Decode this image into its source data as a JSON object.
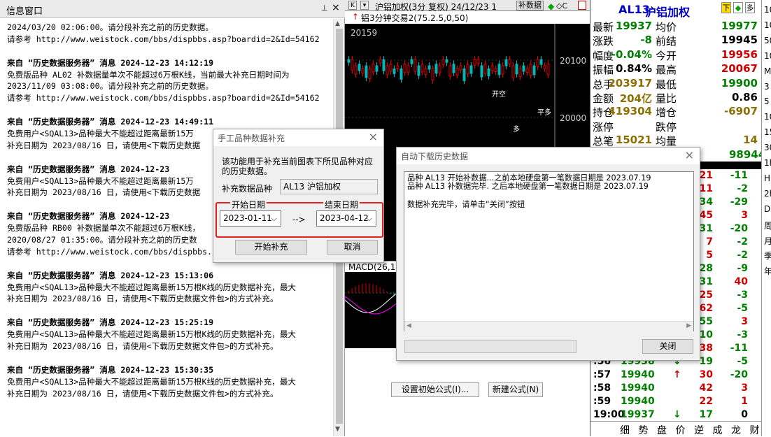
{
  "info_window": {
    "title": "信息窗口",
    "pin": "⊥",
    "close": "×",
    "lines": [
      {
        "t": "2024/03/20 02:06:00。请分段补充之前的历史数据。",
        "b": false
      },
      {
        "t": "请参考 http://www.weistock.com/bbs/dispbbs.asp?boardid=2&Id=54162",
        "b": false
      },
      {
        "t": "",
        "b": false
      },
      {
        "t": "来自 “历史数据服务器” 消息 2024-12-23 14:12:19",
        "b": true
      },
      {
        "t": "免费版品种 AL02 补数据量单次不能超过6万根K线，当前最大补充日期时间为",
        "b": false
      },
      {
        "t": "2023/11/09 03:08:00。请分段补充之前的历史数据。",
        "b": false
      },
      {
        "t": "请参考 http://www.weistock.com/bbs/dispbbs.asp?boardid=2&Id=54162",
        "b": false
      },
      {
        "t": "",
        "b": false
      },
      {
        "t": "来自 “历史数据服务器” 消息 2024-12-23 14:49:11",
        "b": true
      },
      {
        "t": "免费用户<SQAL13>品种最大不能超过距离最新15万",
        "b": false
      },
      {
        "t": "补充日期为 2023/08/16 日，请使用<下载历史数据",
        "b": false
      },
      {
        "t": "",
        "b": false
      },
      {
        "t": "来自 “历史数据服务器” 消息 2024-12-23",
        "b": true
      },
      {
        "t": "免费用户<SQAL13>品种最大不能超过距离最新15万",
        "b": false
      },
      {
        "t": "补充日期为 2023/08/16 日，请使用<下载历史数据",
        "b": false
      },
      {
        "t": "",
        "b": false
      },
      {
        "t": "来自 “历史数据服务器” 消息 2024-12-23",
        "b": true
      },
      {
        "t": "免费版品种 RB00 补数据量单次不能超过6万根K线，",
        "b": false
      },
      {
        "t": "2020/08/27 01:35:00。请分段补充之前的历史数",
        "b": false
      },
      {
        "t": "请参考 http://www.weistock.com/bbs/dispbbs.",
        "b": false
      },
      {
        "t": "",
        "b": false
      },
      {
        "t": "来自 “历史数据服务器” 消息 2024-12-23 15:13:06",
        "b": true
      },
      {
        "t": "免费用户<SQAL13>品种最大不能超过距离最新15万根K线的历史数据补充，最大",
        "b": false
      },
      {
        "t": "补充日期为 2023/08/16 日，请使用<下载历史数据文件包>的方式补充。",
        "b": false
      },
      {
        "t": "",
        "b": false
      },
      {
        "t": "来自 “历史数据服务器” 消息 2024-12-23 15:25:19",
        "b": true
      },
      {
        "t": "免费用户<SQAL13>品种最大不能超过距离最新15万根K线的历史数据补充，最大",
        "b": false
      },
      {
        "t": "补充日期为 2023/08/16 日，请使用<下载历史数据文件包>的方式补充。",
        "b": false
      },
      {
        "t": "",
        "b": false
      },
      {
        "t": "来自 “历史数据服务器” 消息 2024-12-23 15:30:35",
        "b": true
      },
      {
        "t": "免费用户<SQAL13>品种最大不能超过距离最新15万根K线的历史数据补充，最大",
        "b": false
      },
      {
        "t": "补充日期为 2023/08/16 日，请使用<下载历史数据文件包>的方式补充。",
        "b": false
      }
    ]
  },
  "chart": {
    "k_button": "K",
    "header": "沪铝加权(3分  复权) 24/12/23 1",
    "bsj_button": "补数据",
    "indicator": "铝3分钟交易2(75.2.5,0,50)",
    "price_top": "20159",
    "price_mid": "20100",
    "price_low": "20000",
    "macd": "MACD(26,12",
    "btn_formula": "设置初始公式(I)...",
    "btn_new_formula": "新建公式(N)",
    "labels": [
      "开空",
      "多",
      "平多"
    ]
  },
  "quote": {
    "symbol": "AL13",
    "name": "沪铝加权",
    "btn_down": "下",
    "btn_menu": "多",
    "rows": [
      {
        "l1": "最新",
        "v1": "19937",
        "c1": "#008000",
        "l2": "均价",
        "v2": "19977",
        "c2": "#008000"
      },
      {
        "l1": "涨跌",
        "v1": "-8",
        "c1": "#008000",
        "l2": "前结",
        "v2": "19945",
        "c2": "#000"
      },
      {
        "l1": "幅度",
        "v1": "-0.04%",
        "c1": "#008000",
        "l2": "今开",
        "v2": "19956",
        "c2": "#d00000"
      },
      {
        "l1": "振幅",
        "v1": "0.84%",
        "c1": "#000",
        "l2": "最高",
        "v2": "20067",
        "c2": "#d00000"
      },
      {
        "l1": "总手",
        "v1": "203917",
        "c1": "#8b6f00",
        "l2": "最低",
        "v2": "19900",
        "c2": "#008000"
      },
      {
        "l1": "金额",
        "v1": "204亿",
        "c1": "#8b6f00",
        "l2": "量比",
        "v2": "0.86",
        "c2": "#000"
      },
      {
        "l1": "持仓",
        "v1": "419304",
        "c1": "#8b6f00",
        "l2": "增仓",
        "v2": "-6907",
        "c2": "#8b6f00"
      },
      {
        "l1": "涨停",
        "v1": "",
        "c1": "#000",
        "l2": "跌停",
        "v2": "",
        "c2": "#000"
      },
      {
        "l1": "总笔",
        "v1": "15021",
        "c1": "#8b6f00",
        "l2": "均量",
        "v2": "14",
        "c2": "#8b6f00"
      }
    ],
    "extra_value": "98944",
    "partial_rows": [
      {
        "a": "21",
        "ac": "#d00000",
        "b": "-11",
        "bc": "#008000"
      },
      {
        "a": "11",
        "ac": "#d00000",
        "b": "-2",
        "bc": "#008000"
      },
      {
        "a": "34",
        "ac": "#008000",
        "b": "-29",
        "bc": "#008000"
      },
      {
        "a": "45",
        "ac": "#d00000",
        "b": "3",
        "bc": "#d00000"
      },
      {
        "a": "31",
        "ac": "#008000",
        "b": "-20",
        "bc": "#008000"
      },
      {
        "a": "7",
        "ac": "#d00000",
        "b": "-2",
        "bc": "#008000"
      },
      {
        "a": "5",
        "ac": "#d00000",
        "b": "-2",
        "bc": "#008000"
      },
      {
        "a": "28",
        "ac": "#008000",
        "b": "-9",
        "bc": "#008000"
      },
      {
        "a": "31",
        "ac": "#008000",
        "b": "40",
        "bc": "#d00000"
      },
      {
        "a": "25",
        "ac": "#d00000",
        "b": "-3",
        "bc": "#008000"
      },
      {
        "a": "62",
        "ac": "#d00000",
        "b": "-5",
        "bc": "#008000"
      },
      {
        "a": "55",
        "ac": "#008000",
        "b": "3",
        "bc": "#d00000"
      },
      {
        "a": "10",
        "ac": "#008000",
        "b": "-3",
        "bc": "#008000"
      },
      {
        "a": "38",
        "ac": "#d00000",
        "b": "-11",
        "bc": "#008000"
      }
    ],
    "ticks": [
      {
        "time": ":56",
        "price": "19938",
        "pc": "#008000",
        "dir": "↓",
        "dc": "#008000",
        "vol": "19",
        "vc": "#008000",
        "chg": "-5",
        "cc": "#008000"
      },
      {
        "time": ":57",
        "price": "19940",
        "pc": "#008000",
        "dir": "↑",
        "dc": "#d00000",
        "vol": "30",
        "vc": "#d00000",
        "chg": "-20",
        "cc": "#008000"
      },
      {
        "time": ":58",
        "price": "19940",
        "pc": "#008000",
        "dir": "",
        "dc": "#000",
        "vol": "42",
        "vc": "#d00000",
        "chg": "3",
        "cc": "#d00000"
      },
      {
        "time": ":59",
        "price": "19940",
        "pc": "#008000",
        "dir": "",
        "dc": "#000",
        "vol": "22",
        "vc": "#d00000",
        "chg": "1",
        "cc": "#d00000"
      },
      {
        "time": "19:00",
        "price": "19937",
        "pc": "#008000",
        "dir": "↓",
        "dc": "#008000",
        "vol": "17",
        "vc": "#008000",
        "chg": "0",
        "cc": "#000"
      }
    ],
    "tabs": [
      "细",
      "势",
      "盘",
      "价",
      "逆",
      "成",
      "龙",
      "财"
    ]
  },
  "side_strip": [
    "10",
    "10",
    "50",
    "10",
    "Mo",
    "3",
    "5",
    "10",
    "15",
    "30",
    "1h",
    "Hr",
    "2h",
    "Da",
    "周",
    "月",
    "季",
    "年"
  ],
  "dialog_manual": {
    "title": "手工品种数据补充",
    "close": "×",
    "desc_line1": "该功能用于补充当前图表下所见品种对应",
    "desc_line2": "的历史数据。",
    "symbol_label": "补充数据品种",
    "symbol_value": "AL13 沪铝加权",
    "start_label": "开始日期",
    "end_label": "结束日期",
    "start_date": "2023-01-11",
    "end_date": "2023-04-12",
    "arrow": "-->",
    "btn_start": "开始补充",
    "btn_cancel": "取消"
  },
  "dialog_auto": {
    "title": "自动下载历史数据",
    "close": "×",
    "log_lines": [
      "品种 AL13 开始补数据...之前本地硬盘第一笔数据日期是 2023.07.19",
      "品种 AL13 补数据完毕. 之后本地硬盘第一笔数据日期是 2023.07.19",
      "",
      "数据补充完毕，请单击“关闭”按钮"
    ],
    "btn_close": "关闭"
  }
}
